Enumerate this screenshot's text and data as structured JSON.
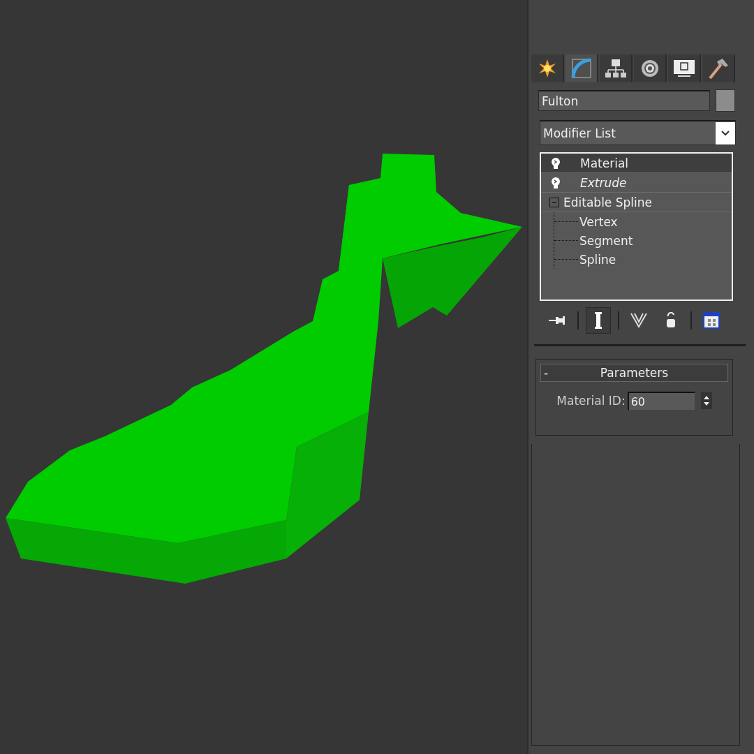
{
  "command_panel": {
    "tabs": [
      {
        "kind": "create",
        "selected": false
      },
      {
        "kind": "modify",
        "selected": true
      },
      {
        "kind": "hierarchy",
        "selected": false
      },
      {
        "kind": "motion",
        "selected": false
      },
      {
        "kind": "display",
        "selected": false
      },
      {
        "kind": "utilities",
        "selected": false
      }
    ],
    "object_name": "Fulton",
    "modifier_list": "Modifier List",
    "stack": {
      "items": [
        {
          "label": "Material",
          "on": true,
          "italic": false,
          "selected": true
        },
        {
          "label": "Extrude",
          "on": true,
          "italic": true,
          "selected": false
        },
        {
          "label": "Editable Spline",
          "expanded": true,
          "selected": false,
          "children": [
            {
              "label": "Vertex"
            },
            {
              "label": "Segment"
            },
            {
              "label": "Spline"
            }
          ]
        }
      ]
    },
    "toolbar": [
      {
        "kind": "pin",
        "selected": false
      },
      {
        "kind": "result",
        "selected": true
      },
      {
        "kind": "unique",
        "selected": false
      },
      {
        "kind": "remove",
        "selected": false
      },
      {
        "kind": "configure",
        "selected": false
      }
    ],
    "rollout": {
      "toggle": "-",
      "title": "Parameters",
      "field": {
        "label": "Material ID:",
        "value": "60"
      }
    }
  }
}
